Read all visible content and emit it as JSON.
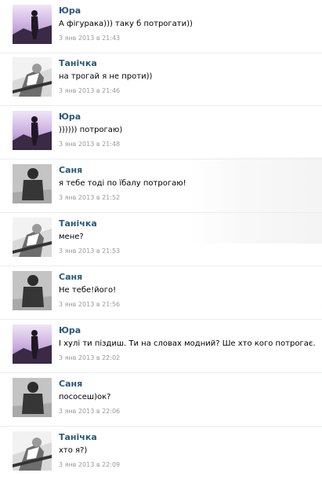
{
  "messages": [
    {
      "author": "Юра",
      "avatar": "yura-avatar-photo",
      "text": "А фігурака))) таку б потрогати))",
      "date": "3 янв 2013 в 21:43"
    },
    {
      "author": "Танічка",
      "avatar": "tanichka-avatar-photo",
      "text": "на трогай я не проти))",
      "date": "3 янв 2013 в 21:46"
    },
    {
      "author": "Юра",
      "avatar": "yura-avatar-photo",
      "text": ")))))) потрогаю)",
      "date": "3 янв 2013 в 21:48"
    },
    {
      "author": "Саня",
      "avatar": "sanya-avatar-photo",
      "text": "я тебе тоді по їбалу потрогаю!",
      "date": "3 янв 2013 в 21:52"
    },
    {
      "author": "Танічка",
      "avatar": "tanichka-avatar-photo",
      "text": "мене?",
      "date": "3 янв 2013 в 21:53"
    },
    {
      "author": "Саня",
      "avatar": "sanya-avatar-photo",
      "text": "Не тебе!його!",
      "date": "3 янв 2013 в 21:56"
    },
    {
      "author": "Юра",
      "avatar": "yura-avatar-photo",
      "text": "І хулі ти піздиш. Ти на словах модний? Ше хто кого потрогає.",
      "date": "3 янв 2013 в 22:02"
    },
    {
      "author": "Саня",
      "avatar": "sanya-avatar-photo",
      "text": "пососеш)ок?",
      "date": "3 янв 2013 в 22:06"
    },
    {
      "author": "Танічка",
      "avatar": "tanichka-avatar-photo",
      "text": "хто я?)",
      "date": "3 янв 2013 в 22:09"
    }
  ]
}
